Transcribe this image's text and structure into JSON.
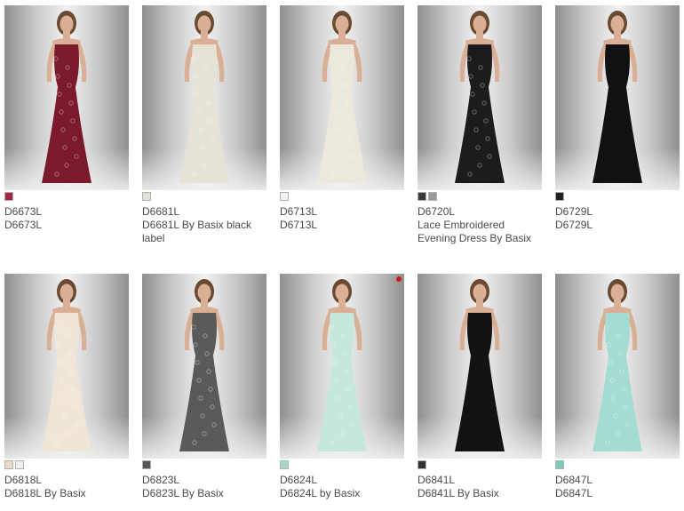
{
  "products": [
    {
      "code": "D6673L",
      "name": "D6673L",
      "swatches": [
        "#a02840"
      ],
      "dress": "#7a1a2c",
      "lace": true
    },
    {
      "code": "D6681L",
      "name": "D6681L By Basix black label",
      "swatches": [
        "#e4e0d6"
      ],
      "dress": "#e6e2d6",
      "lace": true
    },
    {
      "code": "D6713L",
      "name": "D6713L",
      "swatches": [
        "#f2f0ea"
      ],
      "dress": "#ece8dc",
      "lace": true
    },
    {
      "code": "D6720L",
      "name": "Lace Embroidered Evening Dress By Basix",
      "swatches": [
        "#3a3a3a",
        "#9a9a9a"
      ],
      "dress": "#1c1c1c",
      "lace": true
    },
    {
      "code": "D6729L",
      "name": "D6729L",
      "swatches": [
        "#222222"
      ],
      "dress": "#111111",
      "lace": false
    },
    {
      "code": "D6818L",
      "name": "D6818L By Basix",
      "swatches": [
        "#ead8c8",
        "#f0efea"
      ],
      "dress": "#efe6d8",
      "lace": true
    },
    {
      "code": "D6823L",
      "name": "D6823L By Basix",
      "swatches": [
        "#555555"
      ],
      "dress": "#5a5a58",
      "lace": true
    },
    {
      "code": "D6824L",
      "name": "D6824L by Basix",
      "swatches": [
        "#a8d8c8"
      ],
      "dress": "#c6e8dc",
      "lace": true
    },
    {
      "code": "D6841L",
      "name": "D6841L By Basix",
      "swatches": [
        "#333333"
      ],
      "dress": "#121212",
      "lace": false
    },
    {
      "code": "D6847L",
      "name": "D6847L",
      "swatches": [
        "#7ec8bc"
      ],
      "dress": "#a4dcd2",
      "lace": true
    }
  ],
  "colors": {
    "skin": "#d9b096",
    "hair": "#6a4a32",
    "text": "#4a4a4a"
  }
}
